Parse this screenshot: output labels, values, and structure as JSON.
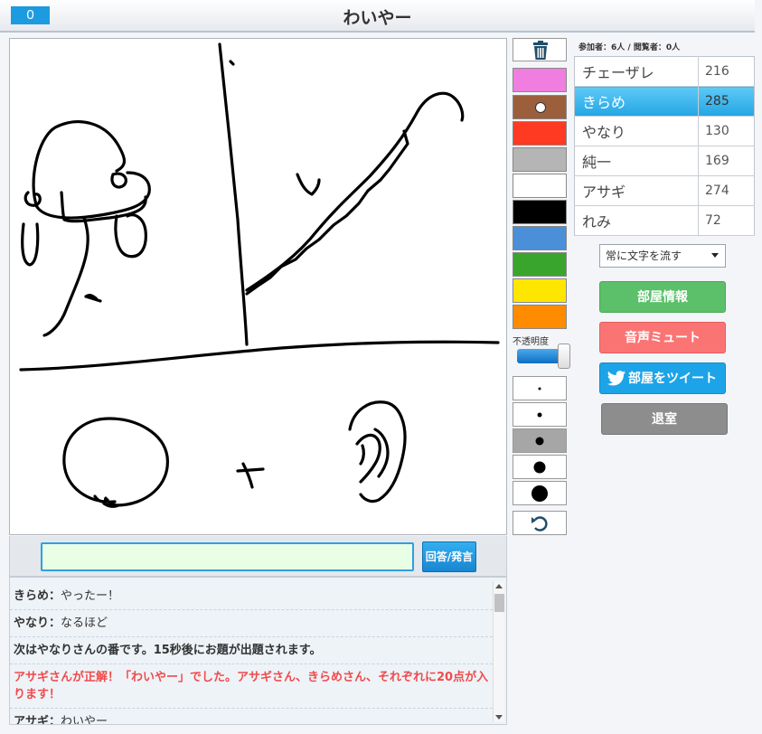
{
  "header": {
    "score": "0",
    "title": "わいやー"
  },
  "answer": {
    "input_value": "",
    "button_label": "回答/発言"
  },
  "chat": {
    "messages": [
      {
        "name": "きらめ：",
        "text": "やったー！"
      },
      {
        "name": "やなり：",
        "text": "なるほど"
      },
      {
        "system": "次はやなりさんの番です。15秒後にお題が出題されます。"
      },
      {
        "win": "アサギさんが正解！「わいやー」でした。アサギさん、きらめさん、それぞれに20点が入ります！"
      },
      {
        "name": "アサギ：",
        "text": "わいやー"
      }
    ]
  },
  "tools": {
    "trash_icon": "trash-icon",
    "colors": [
      "#f07ee0",
      "#9c5f3c",
      "#ff3a22",
      "#b5b5b5",
      "#ffffff",
      "#000000",
      "#4a8fd8",
      "#3aa52c",
      "#ffe600",
      "#ff8c00"
    ],
    "selected_color_index": 1,
    "opacity_label": "不透明度",
    "opacity_value": 1.0,
    "brush_sizes": [
      "xs",
      "s",
      "m",
      "l",
      "xl"
    ],
    "selected_brush_index": 2,
    "undo_icon": "undo-icon"
  },
  "room": {
    "participants_text": "参加者：6人 / 閲覧者：0人",
    "players": [
      {
        "name": "チェーザレ",
        "score": "216"
      },
      {
        "name": "きらめ",
        "score": "285"
      },
      {
        "name": "やなり",
        "score": "130"
      },
      {
        "name": "純一",
        "score": "169"
      },
      {
        "name": "アサギ",
        "score": "274"
      },
      {
        "name": "れみ",
        "score": "72"
      }
    ],
    "active_player_index": 1,
    "text_mode_select": "常に文字を流す",
    "buttons": {
      "info": "部屋情報",
      "mute": "音声ミュート",
      "tweet": "部屋をツイート",
      "exit": "退室"
    }
  }
}
